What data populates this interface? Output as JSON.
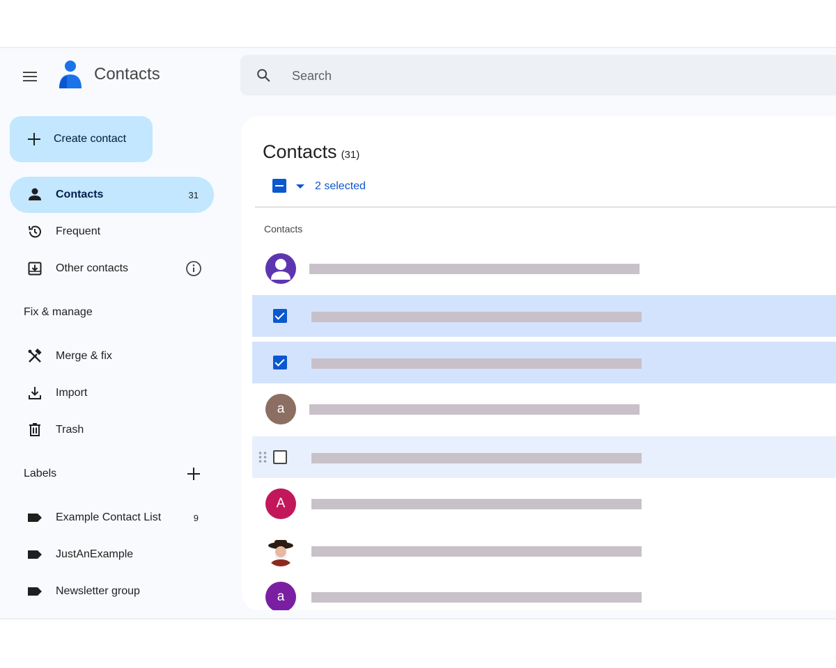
{
  "header": {
    "app_title": "Contacts",
    "search_placeholder": "Search",
    "icons": [
      "menu-icon",
      "contacts-logo-icon",
      "search-icon"
    ]
  },
  "sidebar": {
    "create_label": "Create contact",
    "nav": [
      {
        "label": "Contacts",
        "count": "31",
        "icon": "person-icon",
        "active": true
      },
      {
        "label": "Frequent",
        "icon": "history-icon"
      },
      {
        "label": "Other contacts",
        "icon": "inbox-download-icon"
      }
    ],
    "fix_manage_title": "Fix & manage",
    "fix_manage": [
      {
        "label": "Merge & fix",
        "icon": "merge-fix-icon"
      },
      {
        "label": "Import",
        "icon": "import-icon"
      },
      {
        "label": "Trash",
        "icon": "trash-icon"
      }
    ],
    "labels_title": "Labels",
    "labels": [
      {
        "label": "Example Contact List",
        "count": "9",
        "icon": "label-icon"
      },
      {
        "label": "JustAnExample",
        "icon": "label-icon"
      },
      {
        "label": "Newsletter group",
        "icon": "label-icon"
      }
    ]
  },
  "main": {
    "title": "Contacts",
    "count": "(31)",
    "selection_text": "2 selected",
    "list_header": "Contacts",
    "rows": [
      {
        "avatar": "",
        "avatar_color": "#5e35b1",
        "state": "avatar-default"
      },
      {
        "state": "checked"
      },
      {
        "state": "checked"
      },
      {
        "avatar": "a",
        "avatar_color": "#8d6e63",
        "state": "avatar"
      },
      {
        "state": "unchecked-hover"
      },
      {
        "avatar": "A",
        "avatar_color": "#c2185b",
        "state": "avatar"
      },
      {
        "avatar": "",
        "state": "avatar-photo"
      },
      {
        "avatar": "a",
        "avatar_color": "#7b1fa2",
        "state": "avatar"
      }
    ]
  },
  "colors": {
    "accent": "#0b57d0",
    "active_nav": "#c2e7ff",
    "selected_row": "#d3e3fd",
    "redaction": "#c9c1c9"
  }
}
